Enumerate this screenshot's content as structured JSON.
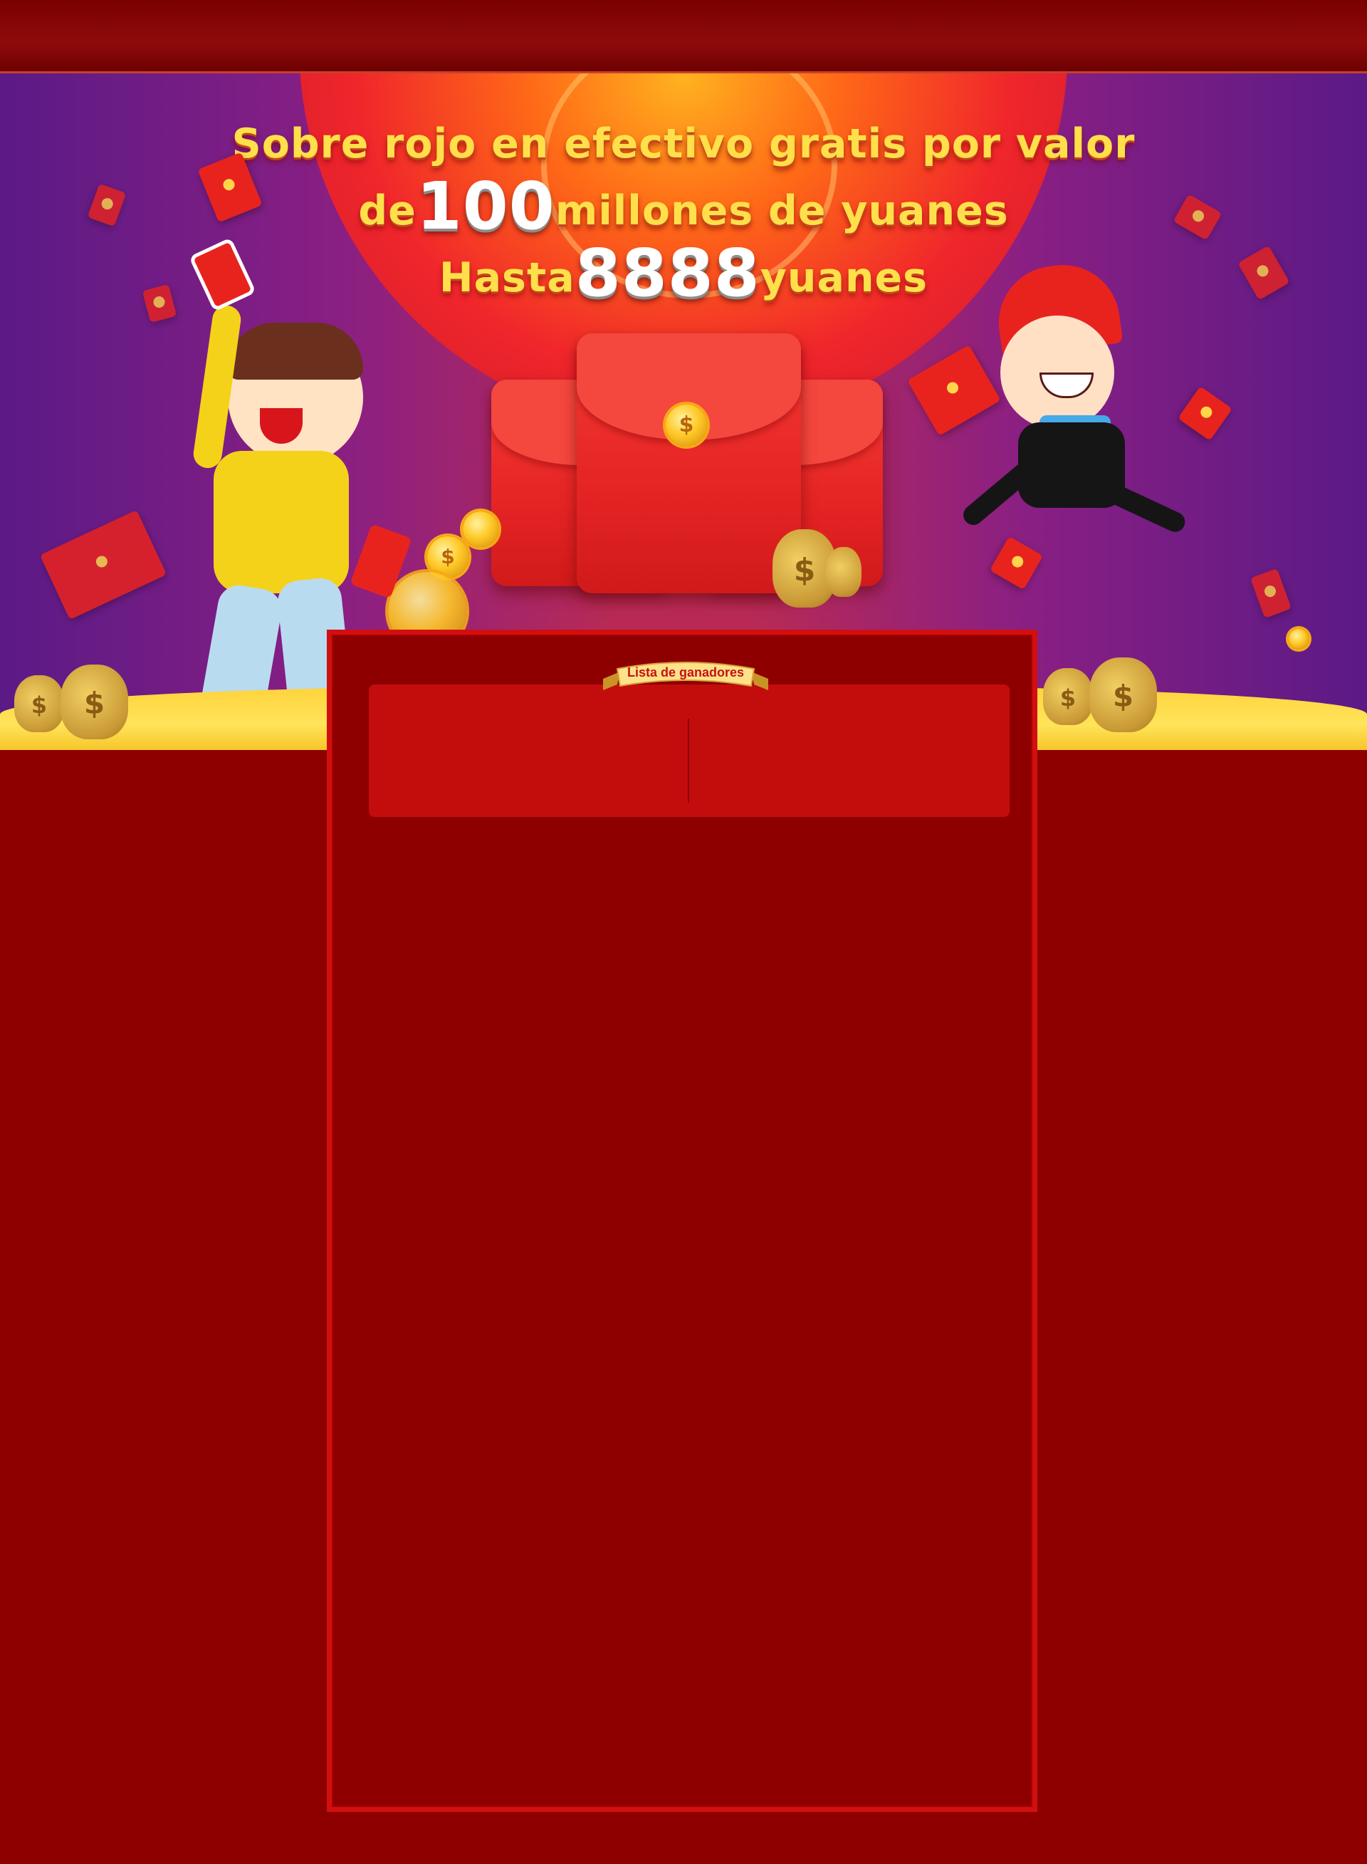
{
  "headline": {
    "line1": "Sobre rojo en efectivo gratis por valor",
    "line2_prefix": "de",
    "line2_number": "100",
    "line2_suffix": "millones de yuanes",
    "line3_prefix": "Hasta",
    "line3_number": "8888",
    "line3_suffix": "yuanes"
  },
  "winners": {
    "title": "Lista de ganadores"
  },
  "decor": {
    "coin_symbol": "$",
    "bag_symbol": "$"
  },
  "colors": {
    "page_background": "#8e0000",
    "headline_gold": "#ffe04a",
    "panel_border": "#d20f0f",
    "winners_box": "#c30d0d"
  }
}
